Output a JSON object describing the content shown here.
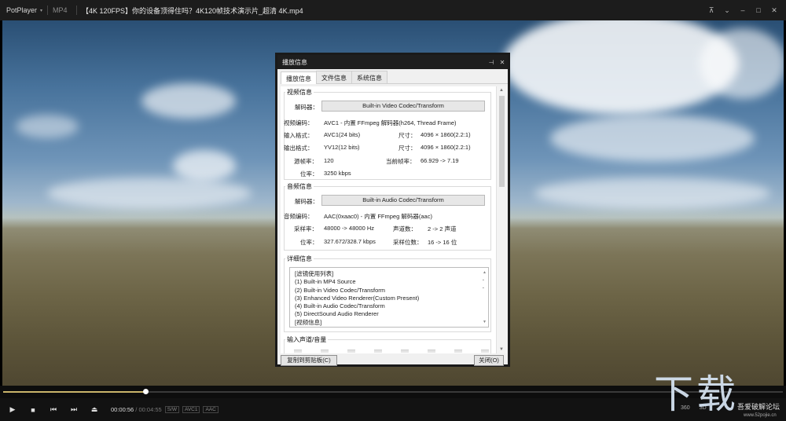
{
  "titlebar": {
    "app_name": "PotPlayer",
    "menu_caret": "▾",
    "format": "MP4",
    "file_title": "【4K 120FPS】你的设备顶得住吗？4K120帧技术演示片_超清 4K.mp4",
    "pin_icon": "⊼",
    "menu_icon": "⌄",
    "minimize_icon": "–",
    "maximize_icon": "□",
    "close_icon": "✕"
  },
  "dialog": {
    "title": "播放信息",
    "pin_icon": "⊣",
    "close_icon": "✕",
    "tabs": [
      "播放信息",
      "文件信息",
      "系统信息"
    ],
    "video": {
      "group_title": "视频信息",
      "decoder_label": "解码器：",
      "decoder_value": "Built-in Video Codec/Transform",
      "codec_label": "视频编码：",
      "codec_value": "AVC1 - 内置 FFmpeg 解码器(h264, Thread Frame)",
      "input_label": "输入格式：",
      "input_value": "AVC1(24 bits)",
      "input_size_label": "尺寸：",
      "input_size_value": "4096 × 1860(2.2:1)",
      "output_label": "输出格式：",
      "output_value": "YV12(12 bits)",
      "output_size_label": "尺寸：",
      "output_size_value": "4096 × 1860(2.2:1)",
      "src_fps_label": "源帧率：",
      "src_fps_value": "120",
      "cur_fps_label": "当前帧率：",
      "cur_fps_value": "66.929 -> 7.19",
      "bitrate_label": "位率：",
      "bitrate_value": "3250 kbps"
    },
    "audio": {
      "group_title": "音频信息",
      "decoder_label": "解码器：",
      "decoder_value": "Built-in Audio Codec/Transform",
      "codec_label": "音频编码：",
      "codec_value": "AAC(0xaac0) - 内置 FFmpeg 解码器(aac)",
      "sample_label": "采样率：",
      "sample_value": "48000 -> 48000 Hz",
      "channels_label": "声道数：",
      "channels_value": "2 -> 2 声道",
      "bitrate_label": "位率：",
      "bitrate_value": "327.672/328.7 kbps",
      "bits_label": "采样位数：",
      "bits_value": "16 -> 16 位"
    },
    "details": {
      "group_title": "详细信息",
      "lines": [
        "[滤镜使用列表]",
        "  (1) Built-in MP4 Source",
        "  (2) Built-in Video Codec/Transform",
        "  (3) Enhanced Video Renderer(Custom Present)",
        "  (4) Built-in Audio Codec/Transform",
        "  (5) DirectSound Audio Renderer",
        "",
        "[视频信息]"
      ]
    },
    "levels": {
      "group_title": "输入声道/音量"
    },
    "copy_button": "复制到剪贴板(C)",
    "close_button": "关闭(O)"
  },
  "playback": {
    "progress": 0.182,
    "current_time": "00:00:56",
    "total_time": "00:04:55",
    "separator": "/",
    "badges": [
      "S/W",
      "AVC1",
      "AAC"
    ],
    "right_labels": [
      "360",
      "3D"
    ],
    "icons": {
      "play": "▶",
      "stop": "■",
      "prev": "⏮",
      "next": "⏭",
      "eject": "⏏"
    }
  },
  "watermark": {
    "big": "下载",
    "small": "吾爱破解论坛",
    "url": "www.52pojie.cn"
  },
  "colors": {
    "titlebar_bg": "#1c1c1c",
    "dialog_title_bg": "#1e1e1e",
    "seek_fill": "#c9b46a",
    "controls_bg": "#121212"
  }
}
